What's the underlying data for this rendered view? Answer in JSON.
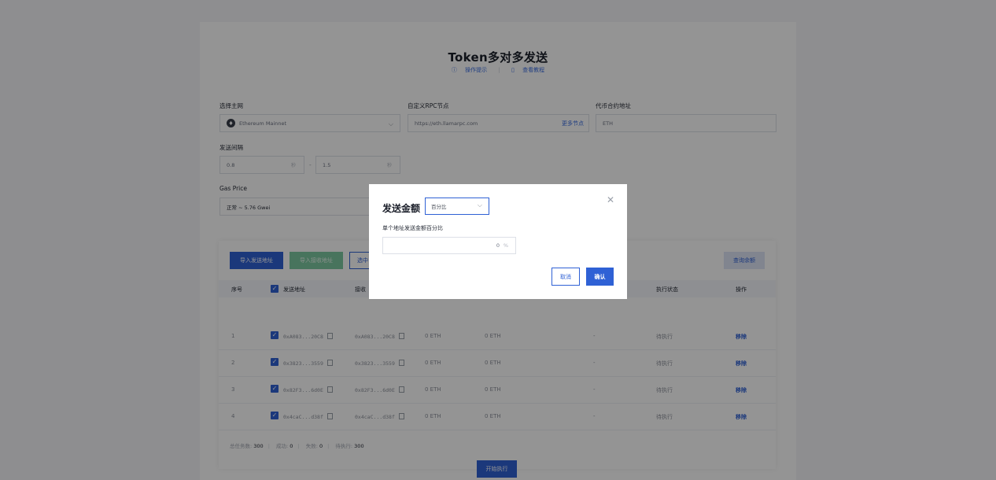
{
  "header": {
    "title": "Token多对多发送",
    "link_tips": "操作提示",
    "link_tutorial": "查看教程"
  },
  "form": {
    "network_label": "选择主网",
    "network_value": "Ethereum Mainnet",
    "rpc_label": "自定义RPC节点",
    "rpc_value": "https://eth.llamarpc.com",
    "rpc_more": "更多节点",
    "contract_label": "代币合约地址",
    "contract_value": "ETH",
    "interval_label": "发送间隔",
    "interval_min": "0.8",
    "interval_max": "1.5",
    "interval_unit": "秒",
    "interval_sep": "-",
    "gas_label": "Gas Price",
    "gas_value": "正常 ~ 5.76 Gwei"
  },
  "toolbar": {
    "import_send": "导入发送地址",
    "import_receive": "导入接收地址",
    "select": "选中",
    "query_balance": "查询余额"
  },
  "table": {
    "headers": {
      "index": "序号",
      "from": "发送地址",
      "to": "接收",
      "status": "执行状态",
      "action": "操作"
    },
    "rows": [
      {
        "index": "1",
        "from": "0xA083...20C8",
        "to": "0xA083...20C8",
        "bal1": "0 ETH",
        "bal2": "0 ETH",
        "dash": "-",
        "status": "待执行",
        "action": "移除"
      },
      {
        "index": "2",
        "from": "0x3823...3559",
        "to": "0x3823...3559",
        "bal1": "0 ETH",
        "bal2": "0 ETH",
        "dash": "-",
        "status": "待执行",
        "action": "移除"
      },
      {
        "index": "3",
        "from": "0x82F3...6d0E",
        "to": "0x82F3...6d0E",
        "bal1": "0 ETH",
        "bal2": "0 ETH",
        "dash": "-",
        "status": "待执行",
        "action": "移除"
      },
      {
        "index": "4",
        "from": "0x4caC...d38f",
        "to": "0x4caC...d38f",
        "bal1": "0 ETH",
        "bal2": "0 ETH",
        "dash": "-",
        "status": "待执行",
        "action": "移除"
      }
    ]
  },
  "stats": {
    "total_label": "总任务数:",
    "total": "300",
    "success_label": "成功:",
    "success": "0",
    "fail_label": "失败:",
    "fail": "0",
    "pending_label": "待执行:",
    "pending": "300"
  },
  "start_button": "开始执行",
  "modal": {
    "title": "发送金额",
    "mode": "百分比",
    "label": "单个地址发送金额百分比",
    "value": "0",
    "unit": "%",
    "cancel": "取消",
    "confirm": "确认"
  },
  "colors": {
    "primary": "#2f61d5",
    "green": "#7cc8a0"
  }
}
